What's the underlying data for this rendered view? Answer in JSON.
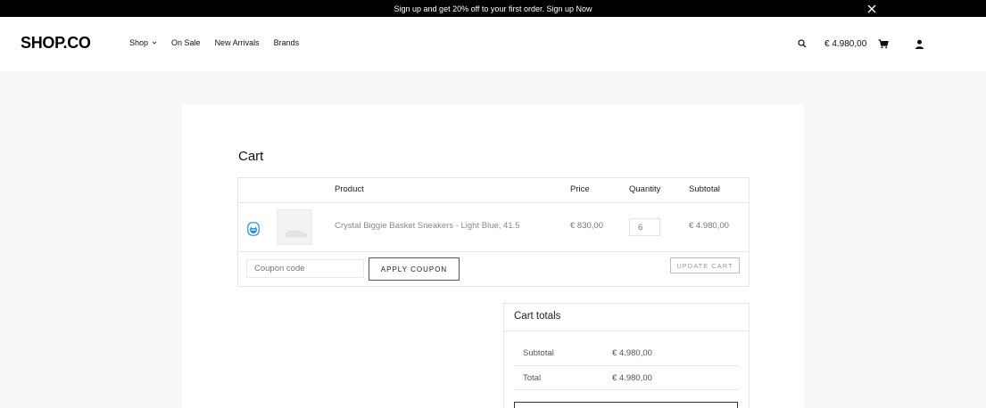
{
  "announcement": {
    "text": "Sign up and get 20% off to your first order. Sign up Now"
  },
  "header": {
    "logo": "SHOP.CO",
    "nav": [
      {
        "label": "Shop",
        "has_dropdown": true
      },
      {
        "label": "On Sale"
      },
      {
        "label": "New Arrivals"
      },
      {
        "label": "Brands"
      }
    ],
    "cart_total": "€ 4.980,00",
    "icons": [
      "search-icon",
      "cart-icon",
      "user-icon",
      "close-icon",
      "chevron-down-icon"
    ]
  },
  "cart": {
    "title": "Cart",
    "columns": {
      "product": "Product",
      "price": "Price",
      "quantity": "Quantity",
      "subtotal": "Subtotal"
    },
    "items": [
      {
        "name": "Crystal Biggie Basket Sneakers - Light Blue, 41.5",
        "price": "€ 830,00",
        "quantity": "6",
        "subtotal": "€ 4.980,00"
      }
    ],
    "coupon_placeholder": "Coupon code",
    "apply_coupon_label": "APPLY COUPON",
    "update_cart_label": "UPDATE CART"
  },
  "totals": {
    "title": "Cart totals",
    "subtotal_label": "Subtotal",
    "subtotal_value": "€ 4.980,00",
    "total_label": "Total",
    "total_value": "€ 4.980,00"
  },
  "colors": {
    "announcement_bg": "#000000",
    "page_bg": "#f7f7f5",
    "accent_remove": "#2a8fd6"
  }
}
